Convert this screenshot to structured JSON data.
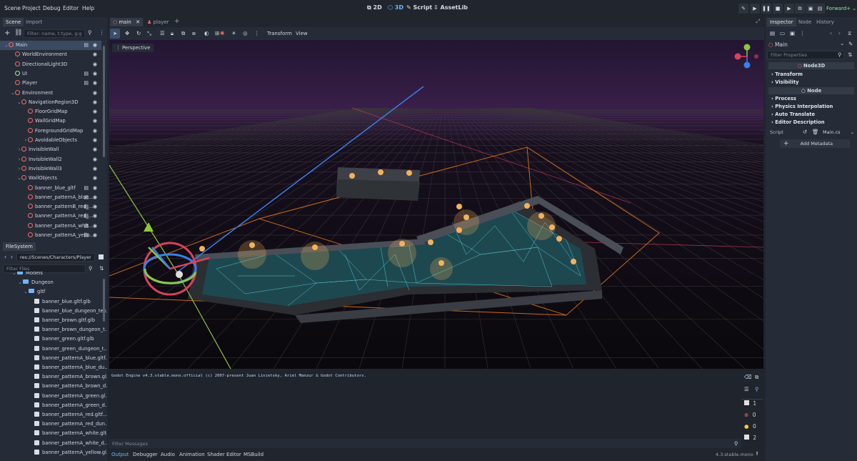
{
  "menu": [
    "Scene",
    "Project",
    "Debug",
    "Editor",
    "Help"
  ],
  "modes": [
    {
      "label": "2D",
      "icon": "2d-icon",
      "active": false
    },
    {
      "label": "3D",
      "icon": "3d-icon",
      "active": true
    },
    {
      "label": "Script",
      "icon": "script-icon",
      "active": false
    },
    {
      "label": "AssetLib",
      "icon": "assetlib-icon",
      "active": false
    }
  ],
  "renderer": "Forward+",
  "scene_panel": {
    "tabs": [
      "Scene",
      "Import"
    ],
    "filter_placeholder": "Filter: name, t:type, g:g",
    "tree": [
      {
        "label": "Main",
        "depth": 0,
        "color": "#f06b6b",
        "selected": true,
        "extra": true
      },
      {
        "label": "WorldEnvironment",
        "depth": 1,
        "color": "#f06b6b"
      },
      {
        "label": "DirectionalLight3D",
        "depth": 1,
        "color": "#f06b6b"
      },
      {
        "label": "UI",
        "depth": 1,
        "color": "#8eef97",
        "extra": true
      },
      {
        "label": "Player",
        "depth": 1,
        "color": "#f06b6b",
        "extra": true
      },
      {
        "label": "Environment",
        "depth": 1,
        "color": "#f06b6b"
      },
      {
        "label": "NavigationRegion3D",
        "depth": 2,
        "color": "#f06b6b"
      },
      {
        "label": "FloorGridMap",
        "depth": 3,
        "color": "#f06b6b"
      },
      {
        "label": "WallGridMap",
        "depth": 3,
        "color": "#f06b6b"
      },
      {
        "label": "ForegroundGridMap",
        "depth": 3,
        "color": "#f06b6b"
      },
      {
        "label": "AvoidableObjects",
        "depth": 3,
        "color": "#f06b6b"
      },
      {
        "label": "InvisibleWall",
        "depth": 2,
        "color": "#f06b6b"
      },
      {
        "label": "InvisibleWall2",
        "depth": 2,
        "color": "#f06b6b"
      },
      {
        "label": "InvisibleWall3",
        "depth": 2,
        "color": "#f06b6b"
      },
      {
        "label": "WallObjects",
        "depth": 2,
        "color": "#f06b6b"
      },
      {
        "label": "banner_blue_gltf",
        "depth": 3,
        "color": "#f06b6b",
        "extra": true
      },
      {
        "label": "banner_patternA_blue...",
        "depth": 3,
        "color": "#f06b6b",
        "extra": true
      },
      {
        "label": "banner_patternB_red_...",
        "depth": 3,
        "color": "#f06b6b",
        "extra": true
      },
      {
        "label": "banner_patternA_red_...",
        "depth": 3,
        "color": "#f06b6b",
        "extra": true
      },
      {
        "label": "banner_patternA_whit...",
        "depth": 3,
        "color": "#f06b6b",
        "extra": true
      },
      {
        "label": "banner_patternA_yello...",
        "depth": 3,
        "color": "#f06b6b",
        "extra": true
      }
    ]
  },
  "filesystem": {
    "tab": "FileSystem",
    "path": "res://Scenes/Characters/Player/pl",
    "filter_placeholder": "Filter Files",
    "items": [
      {
        "label": "Models",
        "depth": 1,
        "folder": true
      },
      {
        "label": "Dungeon",
        "depth": 2,
        "folder": true
      },
      {
        "label": "gltf",
        "depth": 3,
        "folder": true
      },
      {
        "label": "banner_blue.gltf.glb",
        "depth": 4
      },
      {
        "label": "banner_blue_dungeon_tex...",
        "depth": 4
      },
      {
        "label": "banner_brown.gltf.glb",
        "depth": 4
      },
      {
        "label": "banner_brown_dungeon_t...",
        "depth": 4
      },
      {
        "label": "banner_green.gltf.glb",
        "depth": 4
      },
      {
        "label": "banner_green_dungeon_t...",
        "depth": 4
      },
      {
        "label": "banner_patternA_blue.gltf...",
        "depth": 4
      },
      {
        "label": "banner_patternA_blue_du...",
        "depth": 4
      },
      {
        "label": "banner_patternA_brown.gl...",
        "depth": 4
      },
      {
        "label": "banner_patternA_brown_d...",
        "depth": 4
      },
      {
        "label": "banner_patternA_green.gl...",
        "depth": 4
      },
      {
        "label": "banner_patternA_green_d...",
        "depth": 4
      },
      {
        "label": "banner_patternA_red.gltf...",
        "depth": 4
      },
      {
        "label": "banner_patternA_red_dun...",
        "depth": 4
      },
      {
        "label": "banner_patternA_white.glt...",
        "depth": 4
      },
      {
        "label": "banner_patternA_white_d...",
        "depth": 4
      },
      {
        "label": "banner_patternA_yellow.gl...",
        "depth": 4
      }
    ]
  },
  "editor_tabs": [
    {
      "label": "main",
      "active": true
    },
    {
      "label": "player",
      "active": false
    }
  ],
  "viewport_toolbar": {
    "transform": "Transform",
    "view": "View",
    "perspective": "Perspective"
  },
  "output": {
    "log": "Godot Engine v4.3.stable.mono.official (c) 2007-present Juan Linietsky, Ariel Manzur & Godot Contributors.",
    "filter_placeholder": "Filter Messages",
    "counts": {
      "messages": "1",
      "errors": "0",
      "warnings": "0",
      "info": "2"
    }
  },
  "bottom_tabs": [
    "Output",
    "Debugger",
    "Audio",
    "Animation",
    "Shader Editor",
    "MSBuild"
  ],
  "version": "4.3.stable.mono",
  "inspector": {
    "tabs": [
      "Inspector",
      "Node",
      "History"
    ],
    "node": "Main",
    "filter_placeholder": "Filter Properties",
    "class1": "Node3D",
    "sections1": [
      "Transform",
      "Visibility"
    ],
    "class2": "Node",
    "sections2": [
      "Process",
      "Physics Interpolation",
      "Auto Translate",
      "Editor Description"
    ],
    "script_label": "Script",
    "script_value": "Main.cs",
    "add_metadata": "Add Metadata"
  }
}
